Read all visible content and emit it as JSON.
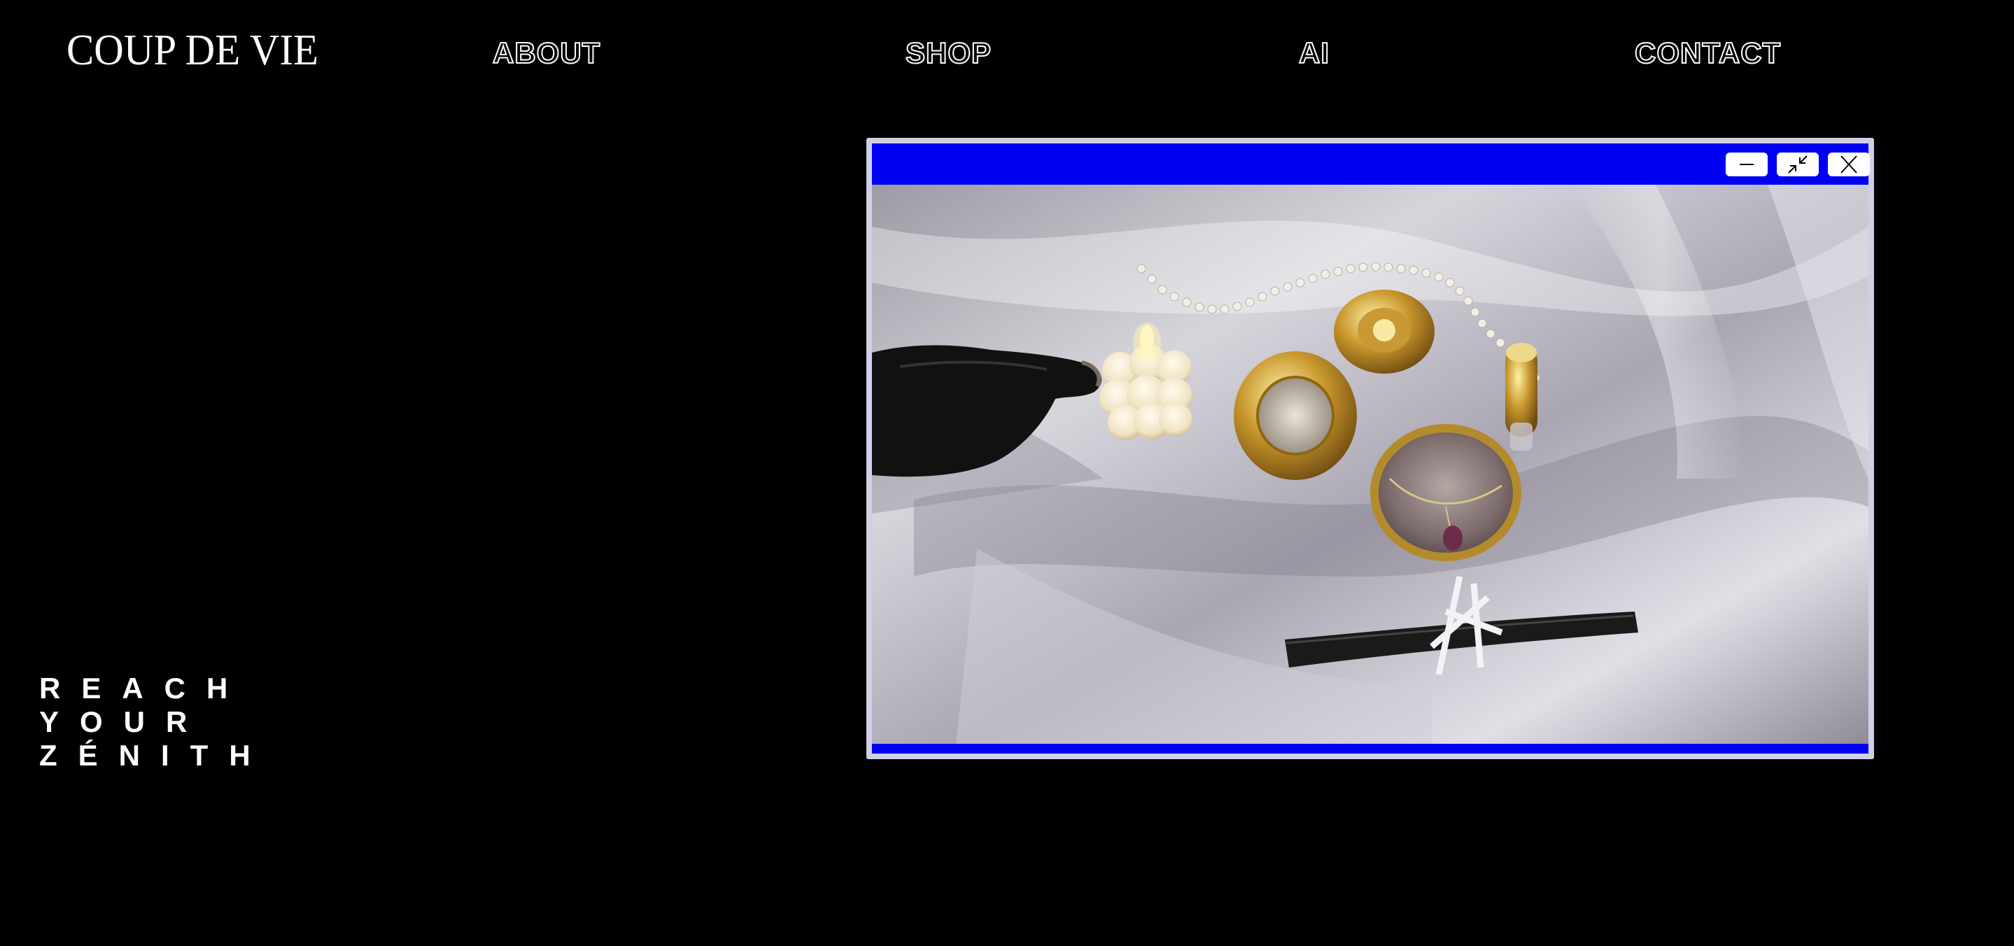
{
  "header": {
    "logo": "COUP DE VIE",
    "nav": {
      "about": "ABOUT",
      "shop": "SHOP",
      "ai": "AI",
      "contact": "CONTACT"
    }
  },
  "hero": {
    "tagline": [
      "REACH",
      "YOUR",
      "ZÉNITH"
    ]
  },
  "media_window": {
    "titlebar_color": "#0000f2",
    "frame_color": "#cfd0e6",
    "buttons": {
      "minimize": "minimize-icon",
      "restore": "restore-icon",
      "close": "close-icon"
    }
  },
  "colors": {
    "background": "#000000",
    "text": "#ffffff",
    "accent": "#0000f2"
  }
}
